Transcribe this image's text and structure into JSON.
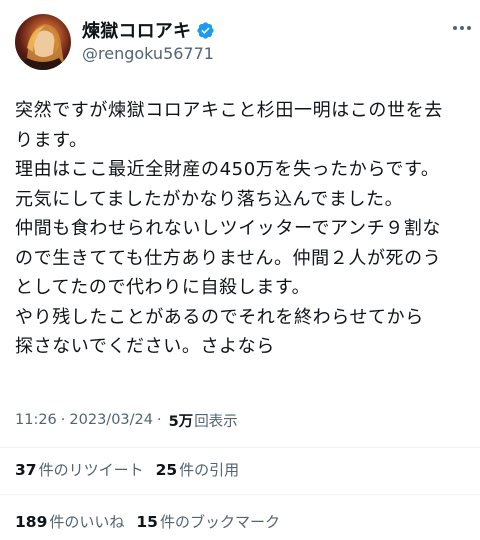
{
  "user": {
    "display_name": "煉獄コロアキ",
    "handle": "@rengoku56771"
  },
  "tweet": {
    "lines": [
      "突然ですが煉獄コロアキこと杉田一明はこの世を去",
      "ります。",
      "理由はここ最近全財産の450万を失ったからです。",
      "元気にしてましたがかなり落ち込んでました。",
      "仲間も食わせられないしツイッターでアンチ９割な",
      "ので生きてても仕方ありません。仲間２人が死のう",
      "としてたので代わりに自殺します。",
      "やり残したことがあるのでそれを終わらせてから",
      "探さないでください。さよなら"
    ]
  },
  "meta": {
    "time": "11:26",
    "separator": "·",
    "date": "2023/03/24",
    "views_count": "5万",
    "views_label": "回表示"
  },
  "stats": {
    "retweets": {
      "count": "37",
      "label": "件のリツイート"
    },
    "quotes": {
      "count": "25",
      "label": "件の引用"
    },
    "likes": {
      "count": "189",
      "label": "件のいいね"
    },
    "bookmarks": {
      "count": "15",
      "label": "件のブックマーク"
    }
  },
  "icons": {
    "avatar": "avatar-image",
    "verified": "verified-badge-icon",
    "more": "more-options-icon"
  },
  "colors": {
    "verified": "#1d9bf0",
    "text": "#0f1419",
    "secondary": "#536471",
    "divider": "#eff3f4"
  }
}
